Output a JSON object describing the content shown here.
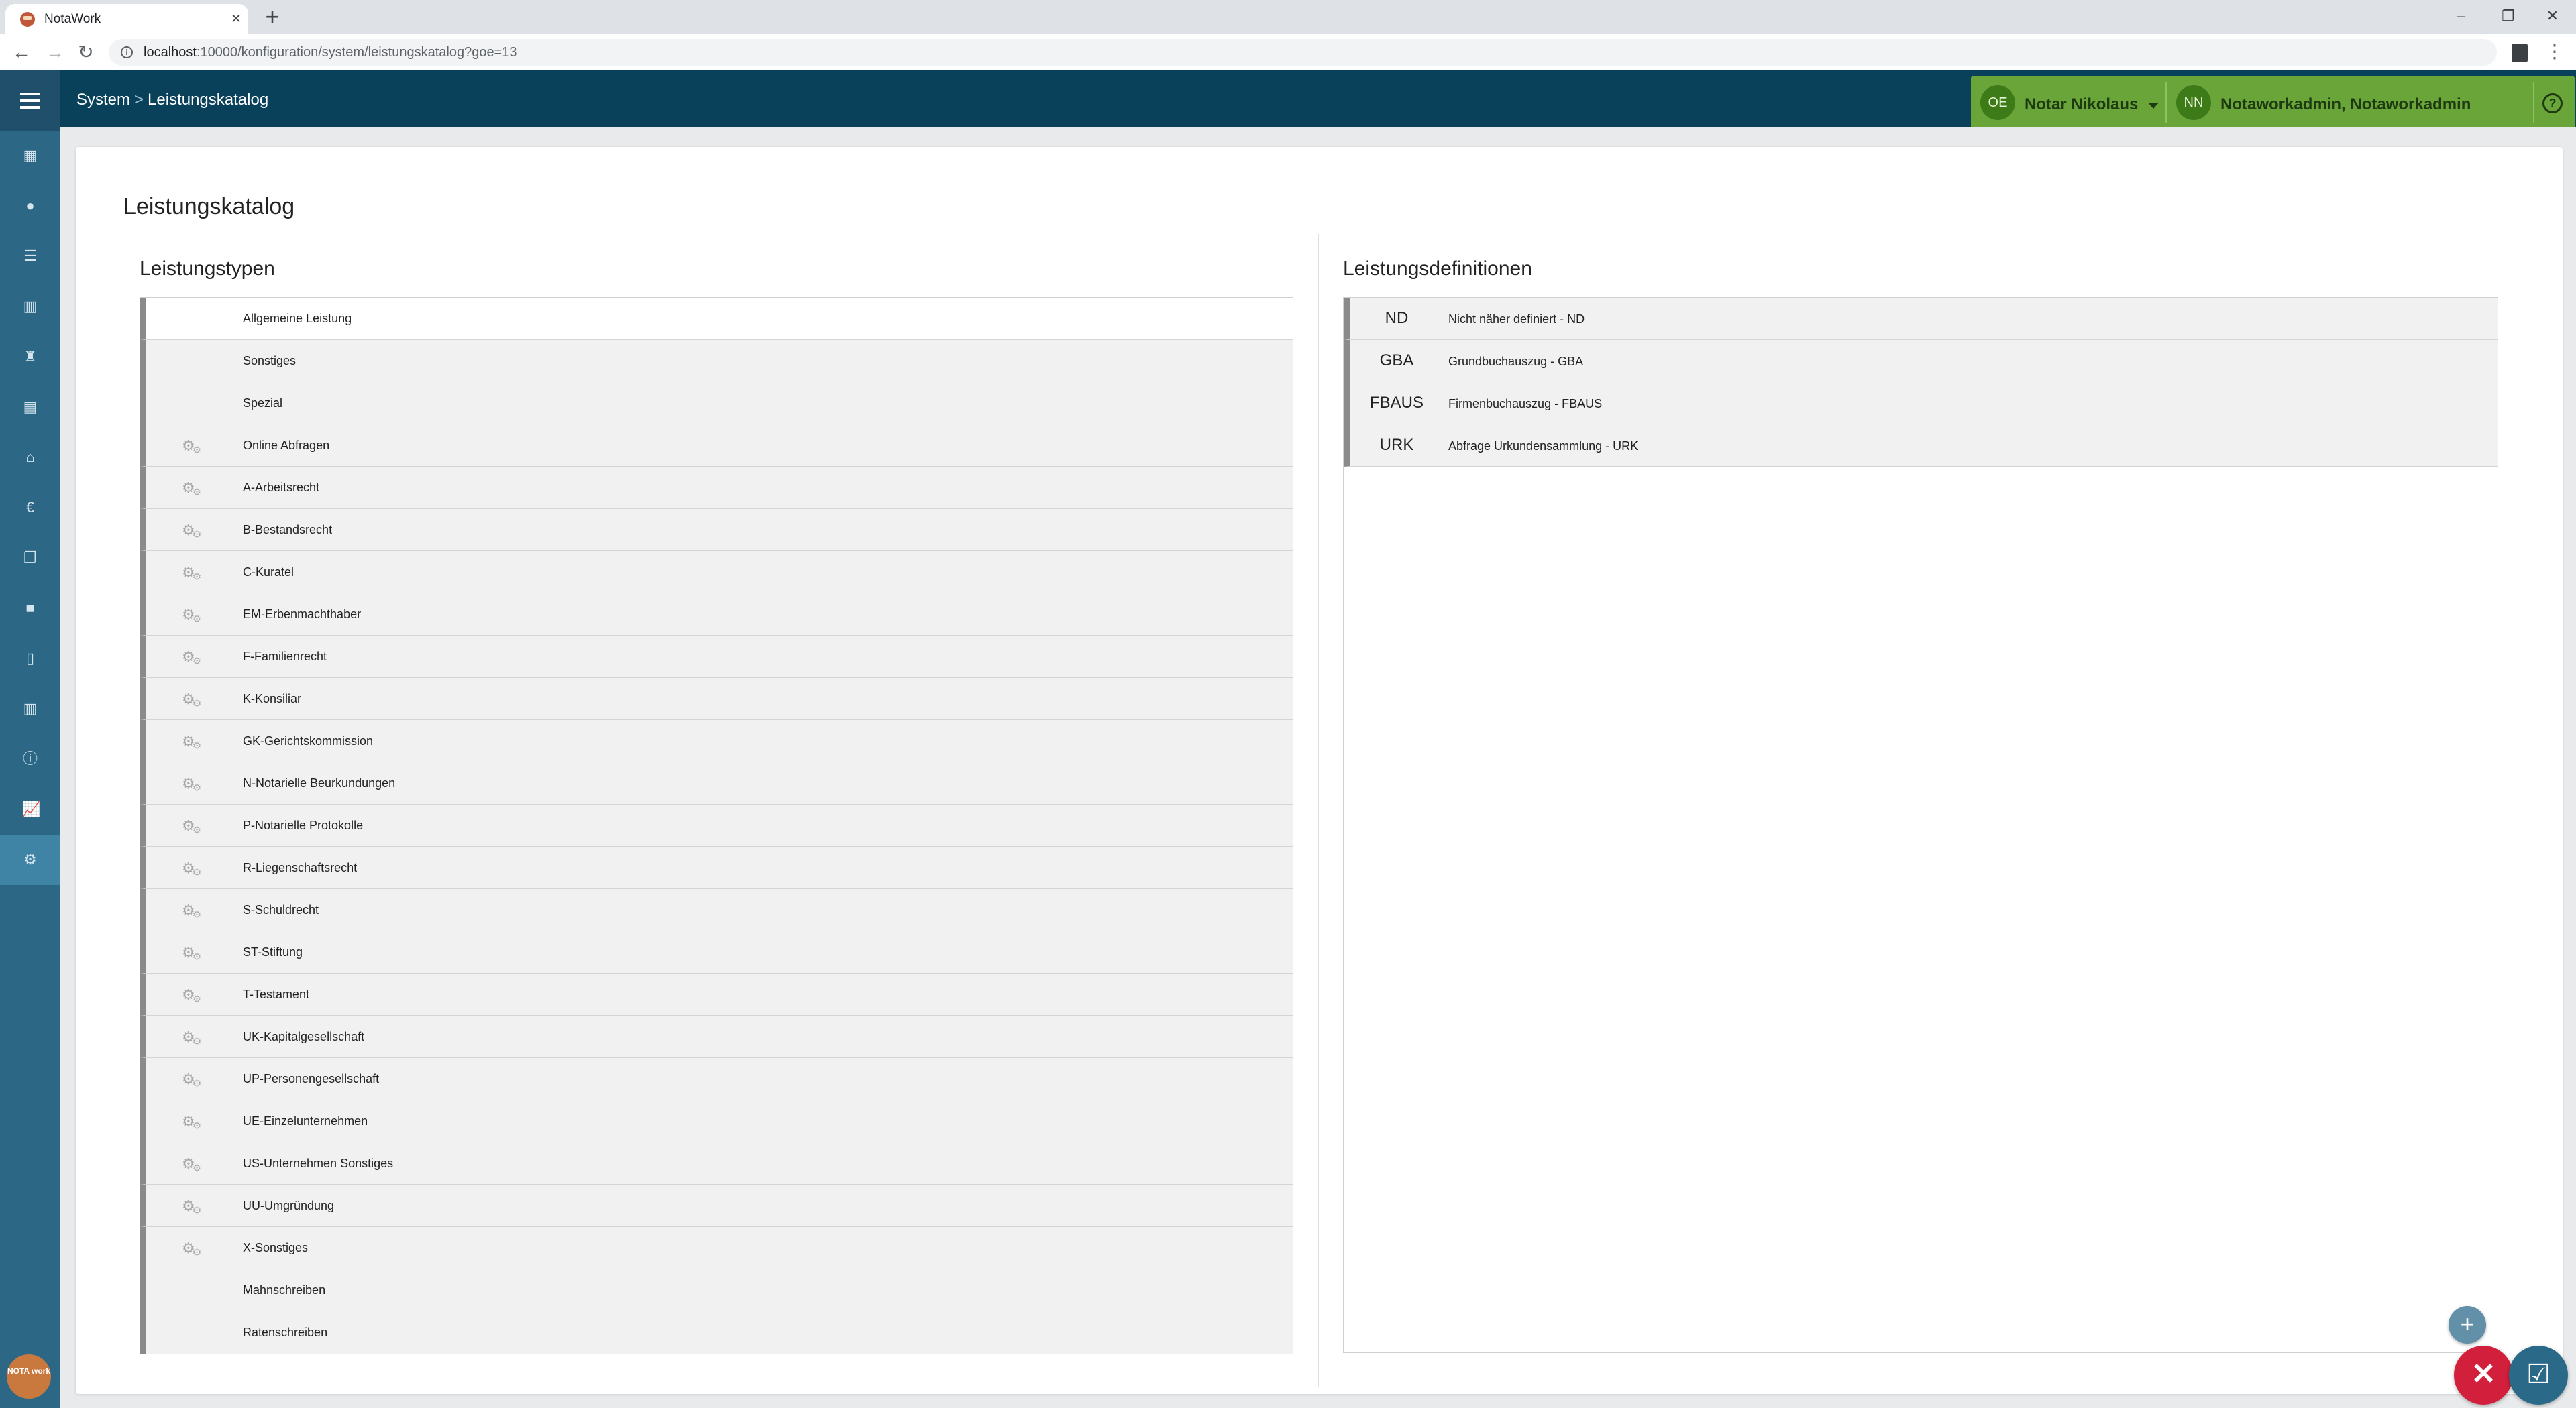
{
  "browser": {
    "tab_title": "NotaWork",
    "url_host": "localhost",
    "url_rest": ":10000/konfiguration/system/leistungskatalog?goe=13"
  },
  "breadcrumb": {
    "parent": "System",
    "separator": ">",
    "current": "Leistungskatalog"
  },
  "user": {
    "office_initials": "OE",
    "office_name": "Notar Nikolaus",
    "user_initials": "NN",
    "user_name": "Notaworkadmin, Notaworkadmin"
  },
  "logo_text": "NOTA work",
  "page_title": "Leistungskatalog",
  "leistungstypen": {
    "title": "Leistungstypen",
    "items": [
      {
        "label": "Allgemeine Leistung",
        "gear": false
      },
      {
        "label": "Sonstiges",
        "gear": false
      },
      {
        "label": "Spezial",
        "gear": false
      },
      {
        "label": "Online Abfragen",
        "gear": true
      },
      {
        "label": "A-Arbeitsrecht",
        "gear": true
      },
      {
        "label": "B-Bestandsrecht",
        "gear": true
      },
      {
        "label": "C-Kuratel",
        "gear": true
      },
      {
        "label": "EM-Erbenmachthaber",
        "gear": true
      },
      {
        "label": "F-Familienrecht",
        "gear": true
      },
      {
        "label": "K-Konsiliar",
        "gear": true
      },
      {
        "label": "GK-Gerichtskommission",
        "gear": true
      },
      {
        "label": "N-Notarielle Beurkundungen",
        "gear": true
      },
      {
        "label": "P-Notarielle Protokolle",
        "gear": true
      },
      {
        "label": "R-Liegenschaftsrecht",
        "gear": true
      },
      {
        "label": "S-Schuldrecht",
        "gear": true
      },
      {
        "label": "ST-Stiftung",
        "gear": true
      },
      {
        "label": "T-Testament",
        "gear": true
      },
      {
        "label": "UK-Kapitalgesellschaft",
        "gear": true
      },
      {
        "label": "UP-Personengesellschaft",
        "gear": true
      },
      {
        "label": "UE-Einzelunternehmen",
        "gear": true
      },
      {
        "label": "US-Unternehmen Sonstiges",
        "gear": true
      },
      {
        "label": "UU-Umgründung",
        "gear": true
      },
      {
        "label": "X-Sonstiges",
        "gear": true
      },
      {
        "label": "Mahnschreiben",
        "gear": false
      },
      {
        "label": "Ratenschreiben",
        "gear": false
      }
    ]
  },
  "leistungsdefinitionen": {
    "title": "Leistungsdefinitionen",
    "items": [
      {
        "code": "ND",
        "label": "Nicht näher definiert - ND"
      },
      {
        "code": "GBA",
        "label": "Grundbuchauszug - GBA"
      },
      {
        "code": "FBAUS",
        "label": "Firmenbuchauszug - FBAUS"
      },
      {
        "code": "URK",
        "label": "Abfrage Urkundensammlung - URK"
      }
    ]
  },
  "colors": {
    "appbar": "#09415b",
    "sidebar": "#2c6886",
    "userbar": "#6aa53a",
    "close_fab": "#d21f3c"
  }
}
